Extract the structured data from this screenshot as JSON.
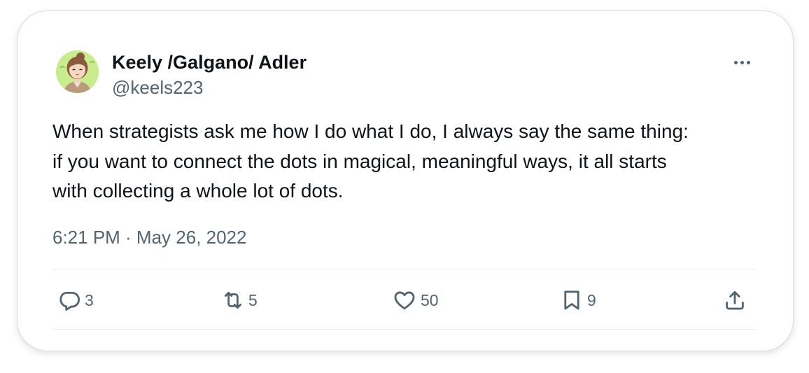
{
  "tweet": {
    "author_name": "Keely /Galgano/ Adler",
    "author_handle": "@keels223",
    "text_lines": [
      "When strategists ask me how I do what I do, I always say the same thing:",
      "if you want to connect the dots in magical, meaningful ways, it all starts",
      "with collecting a whole lot of dots."
    ],
    "timestamp": "6:21 PM · May 26, 2022"
  },
  "actions": {
    "replies": "3",
    "retweets": "5",
    "likes": "50",
    "bookmarks": "9"
  },
  "icons": {
    "avatar": "avatar",
    "more": "more-icon",
    "reply": "reply-icon",
    "retweet": "retweet-icon",
    "like": "heart-icon",
    "bookmark": "bookmark-icon",
    "share": "share-icon"
  },
  "colors": {
    "text_primary": "#0f1419",
    "text_secondary": "#536471",
    "card_border": "#d9dde0",
    "divider": "#e7eaec",
    "avatar_background": "#c9ec8e"
  }
}
